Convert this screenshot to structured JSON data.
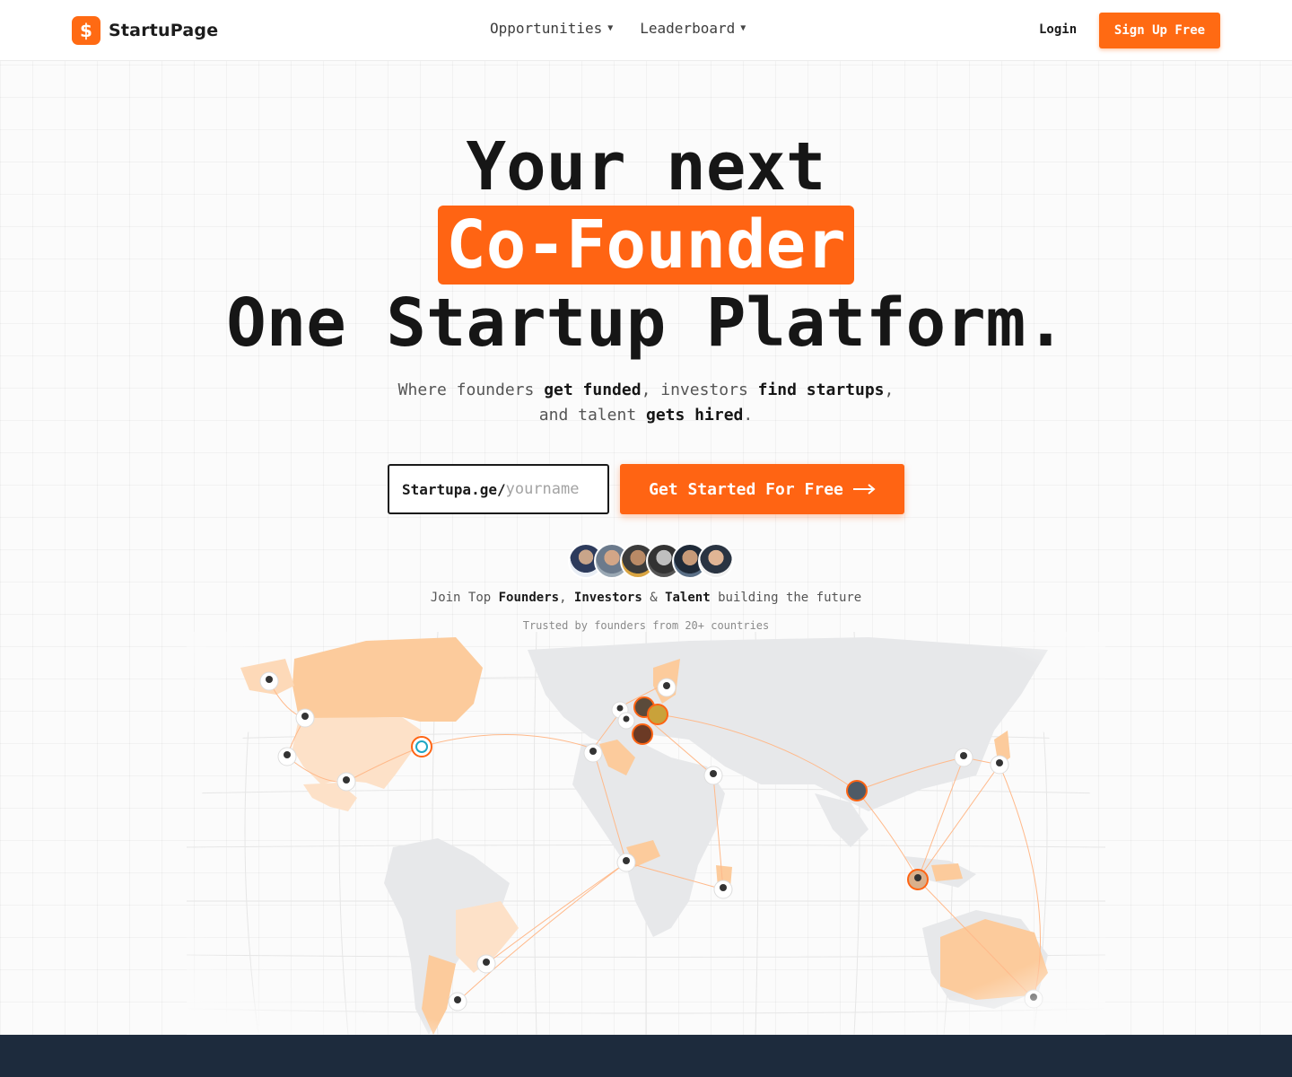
{
  "header": {
    "logo_glyph": "$",
    "logo_text": "StartuPage",
    "nav": [
      {
        "label": "Opportunities"
      },
      {
        "label": "Leaderboard"
      }
    ],
    "login": "Login",
    "signup": "Sign Up Free"
  },
  "hero": {
    "line1": "Your next",
    "line2": "Co-Founder",
    "line3": "One Startup Platform.",
    "sub_a": "Where founders ",
    "sub_b": "get funded",
    "sub_c": ", investors ",
    "sub_d": "find startups",
    "sub_e": ",",
    "sub_f": "and talent ",
    "sub_g": "gets hired",
    "sub_h": "."
  },
  "signup_form": {
    "prefix": "Startupa.ge/",
    "placeholder": "yourname",
    "cta": "Get Started For Free",
    "cta_icon": "arrow-right-icon"
  },
  "social": {
    "join_a": "Join Top ",
    "founders": "Founders",
    "comma": ", ",
    "investors": "Investors",
    "amp": " & ",
    "talent": "Talent",
    "join_b": " building the future",
    "trusted": "Trusted by founders from 20+ countries"
  },
  "colors": {
    "accent": "#ff6413",
    "map_highlight": "#fccb9c",
    "map_light": "#fde1c8",
    "map_base": "#e7e8ea",
    "footer": "#1d2b3d"
  }
}
